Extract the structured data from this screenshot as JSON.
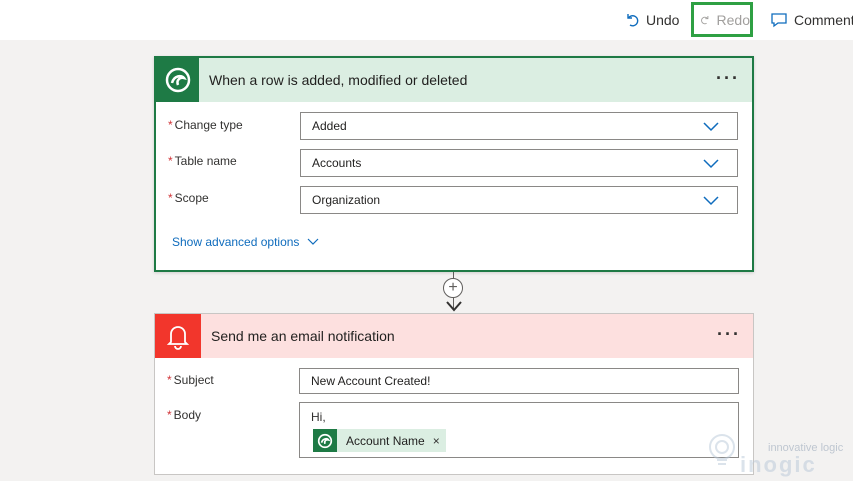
{
  "toolbar": {
    "undo_label": "Undo",
    "redo_label": "Redo",
    "comment_label": "Comment"
  },
  "trigger": {
    "title": "When a row is added, modified or deleted",
    "more": "···",
    "fields": [
      {
        "label": "Change type",
        "value": "Added"
      },
      {
        "label": "Table name",
        "value": "Accounts"
      },
      {
        "label": "Scope",
        "value": "Organization"
      }
    ],
    "advanced": "Show advanced options",
    "accent": "#1e7a45"
  },
  "connector": {
    "plus": "+"
  },
  "action": {
    "title": "Send me an email notification",
    "more": "···",
    "subject_label": "Subject",
    "subject_value": "New Account Created!",
    "body_label": "Body",
    "body_text": "Hi,",
    "token_label": "Account Name",
    "token_remove": "×",
    "accent": "#f2362c"
  },
  "required_mark": "*",
  "watermark": {
    "tagline": "innovative logic",
    "name": "inogic"
  }
}
